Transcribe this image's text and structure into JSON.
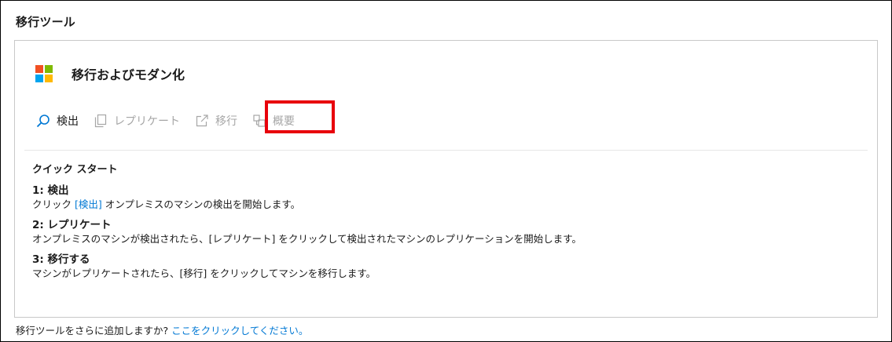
{
  "section_title": "移行ツール",
  "card": {
    "title": "移行およびモダン化",
    "logo_colors": [
      "#f25022",
      "#7fba00",
      "#00a4ef",
      "#ffb900"
    ]
  },
  "toolbar": {
    "discover": {
      "label": "検出",
      "icon": "search-icon",
      "state": "enabled"
    },
    "replicate": {
      "label": "レプリケート",
      "icon": "copy-icon",
      "state": "disabled"
    },
    "migrate": {
      "label": "移行",
      "icon": "external-link-icon",
      "state": "disabled"
    },
    "overview": {
      "label": "概要",
      "icon": "overview-icon",
      "state": "disabled",
      "highlighted": true
    }
  },
  "highlight_color": "#e8000b",
  "quick_start": {
    "title": "クイック スタート",
    "steps": [
      {
        "title": "1: 検出",
        "desc_prefix": "クリック ",
        "desc_link": "[検出]",
        "desc_suffix": " オンプレミスのマシンの検出を開始します。"
      },
      {
        "title": "2: レプリケート",
        "desc": "オンプレミスのマシンが検出されたら、[レプリケート] をクリックして検出されたマシンのレプリケーションを開始します。"
      },
      {
        "title": "3: 移行する",
        "desc": "マシンがレプリケートされたら、[移行] をクリックしてマシンを移行します。"
      }
    ]
  },
  "footer": {
    "text": "移行ツールをさらに追加しますか? ",
    "link": "ここをクリックしてください。"
  }
}
